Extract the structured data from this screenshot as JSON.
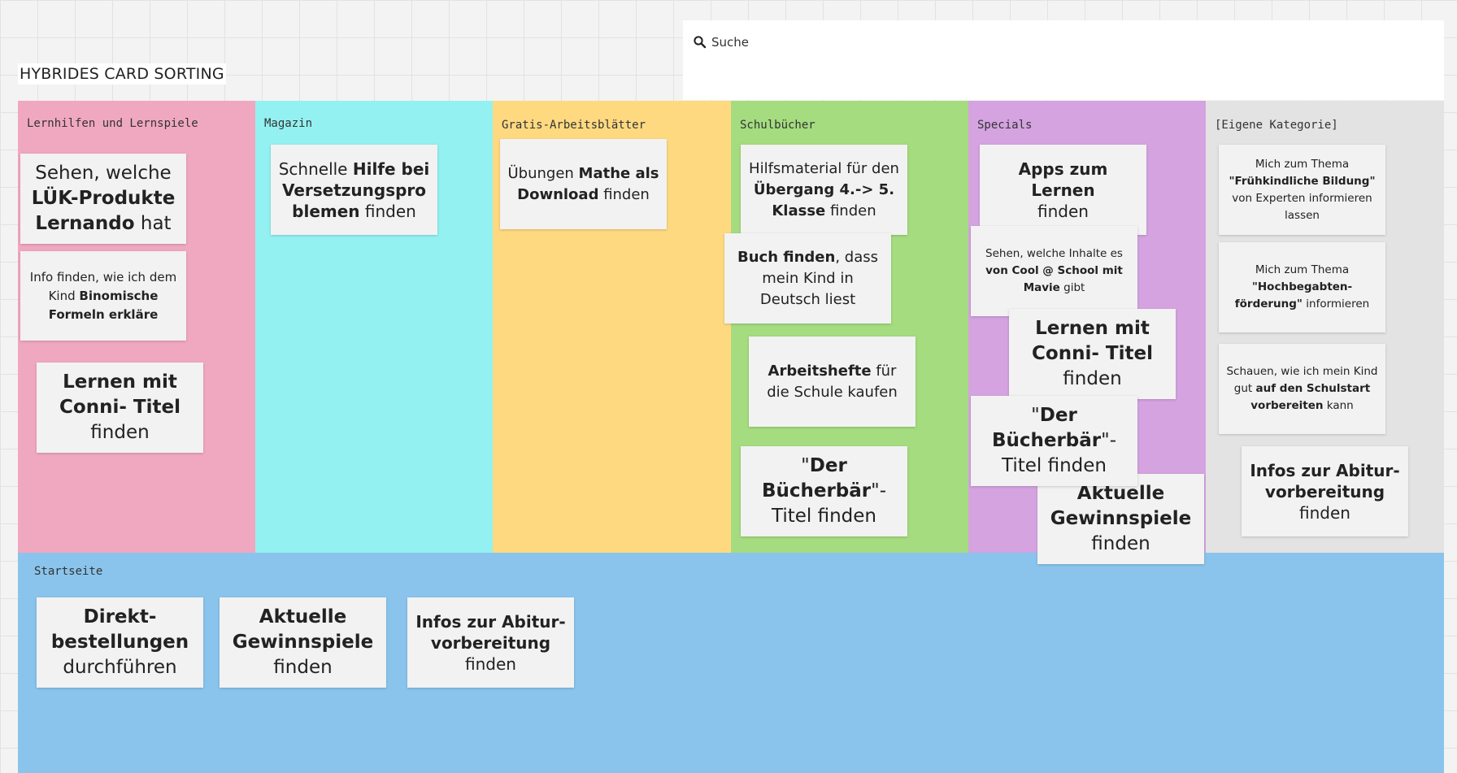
{
  "board": {
    "title": "HYBRIDES CARD SORTING"
  },
  "search": {
    "label": "Suche",
    "icon": "search-icon"
  },
  "colors": {
    "lernhilfen": "#f0a8c0",
    "magazin": "#93f1f1",
    "gratis": "#fed980",
    "schulbuecher": "#a4dc7f",
    "specials": "#d4a3e0",
    "eigene": "#e3e3e3",
    "startseite": "#8ac4ec"
  },
  "columns": [
    {
      "label": "Lernhilfen und Lernspiele"
    },
    {
      "label": "Magazin"
    },
    {
      "label": "Gratis-Arbeitsblätter"
    },
    {
      "label": "Schulbücher"
    },
    {
      "label": "Specials"
    },
    {
      "label": "[Eigene Kategorie]"
    }
  ],
  "startseite": {
    "label": "Startseite"
  },
  "cards": {
    "lernhilfen_1": {
      "a": "Sehen, welche",
      "b": "LÜK-Produkte Lernando",
      "c": " hat"
    },
    "lernhilfen_2": {
      "a": "Info finden, wie ich dem Kind ",
      "b": "Binomische Formeln erkläre"
    },
    "lernhilfen_3": {
      "b": "Lernen mit Conni- Titel",
      "c": "finden"
    },
    "magazin_1": {
      "a": "Schnelle ",
      "b": "Hilfe bei Versetzungspro blemen",
      "c": " finden"
    },
    "gratis_1": {
      "a": "Übungen ",
      "b": "Mathe als Download",
      "c": " finden"
    },
    "schul_1": {
      "a": "Hilfsmaterial für den ",
      "b": "Übergang 4.-> 5. Klasse",
      "c": " finden"
    },
    "schul_2": {
      "b": "Buch finden",
      "c": ", dass mein Kind in Deutsch liest"
    },
    "schul_3": {
      "b": "Arbeitshefte",
      "c": " für die Schule kaufen"
    },
    "schul_4": {
      "a": "\"",
      "b": "Der Bücherbär",
      "c": "\"-Titel finden"
    },
    "spec_1": {
      "b": "Apps zum Lernen",
      "c": "finden"
    },
    "spec_2": {
      "a": "Sehen, welche Inhalte es ",
      "b": "von Cool @ School mit Mavie",
      "c": " gibt"
    },
    "spec_3": {
      "b": "Lernen mit Conni- Titel",
      "c": "finden"
    },
    "spec_4": {
      "a": "\"",
      "b": "Der Bücherbär",
      "c": "\"-Titel finden"
    },
    "spec_5": {
      "b": "Aktuelle Gewinnspiele",
      "c": "finden"
    },
    "eig_1": {
      "a": "Mich zum Thema ",
      "b": "\"Frühkindliche Bildung\"",
      "c": " von Experten informieren lassen"
    },
    "eig_2": {
      "a": "Mich zum Thema ",
      "b": "\"Hochbegabten-förderung\"",
      "c": " informieren"
    },
    "eig_3": {
      "a": "Schauen, wie ich mein Kind gut ",
      "b": "auf den Schulstart vorbereiten",
      "c": " kann"
    },
    "eig_4": {
      "b": "Infos zur Abitur-vorbereitung",
      "c": "finden"
    },
    "start_1": {
      "b": "Direkt-bestellungen",
      "c": "durchführen"
    },
    "start_2": {
      "b": "Aktuelle Gewinnspiele",
      "c": "finden"
    },
    "start_3": {
      "b": "Infos zur Abitur-vorbereitung",
      "c": "finden"
    }
  }
}
